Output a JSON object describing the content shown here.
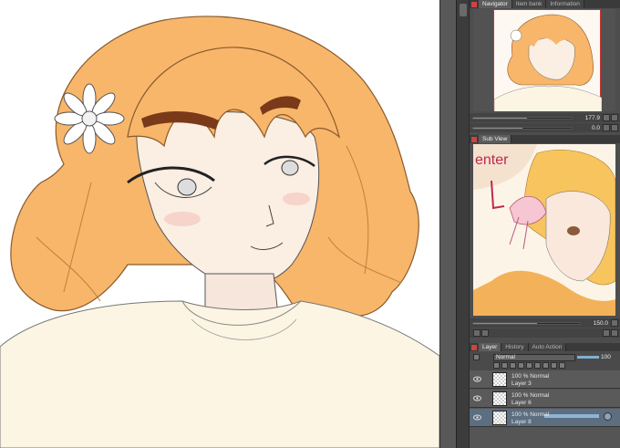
{
  "panels": {
    "navigator": {
      "tabs": [
        {
          "label": "Navigator",
          "active": true
        },
        {
          "label": "Item bank",
          "active": false
        },
        {
          "label": "Information",
          "active": false
        }
      ],
      "zoom": "177.9",
      "rotation": "0.0"
    },
    "subview": {
      "tab_label": "Sub View",
      "sketch_text": "enter",
      "zoom": "150.0"
    },
    "layer": {
      "tabs": [
        {
          "label": "Layer",
          "active": true
        },
        {
          "label": "History",
          "active": false
        },
        {
          "label": "Auto Action",
          "active": false
        }
      ],
      "blend_mode": "Normal",
      "opacity": "100",
      "layers": [
        {
          "mode": "100 % Normal",
          "name": "Layer 3",
          "selected": false
        },
        {
          "mode": "100 % Normal",
          "name": "Layer 6",
          "selected": false
        },
        {
          "mode": "100 % Normal",
          "name": "Layer 8",
          "selected": true
        }
      ]
    }
  },
  "colors": {
    "hair": "#f8b66b",
    "skin": "#fbeee3",
    "sweater": "#fdf5e4",
    "brow": "#7a3a1a",
    "selected_layer": "#5c6e80",
    "panel_bg": "#4d4d4d"
  },
  "icons": [
    "close-icon",
    "eye-icon",
    "flower-icon",
    "lock-icon",
    "zoom-icon",
    "rotate-icon"
  ]
}
